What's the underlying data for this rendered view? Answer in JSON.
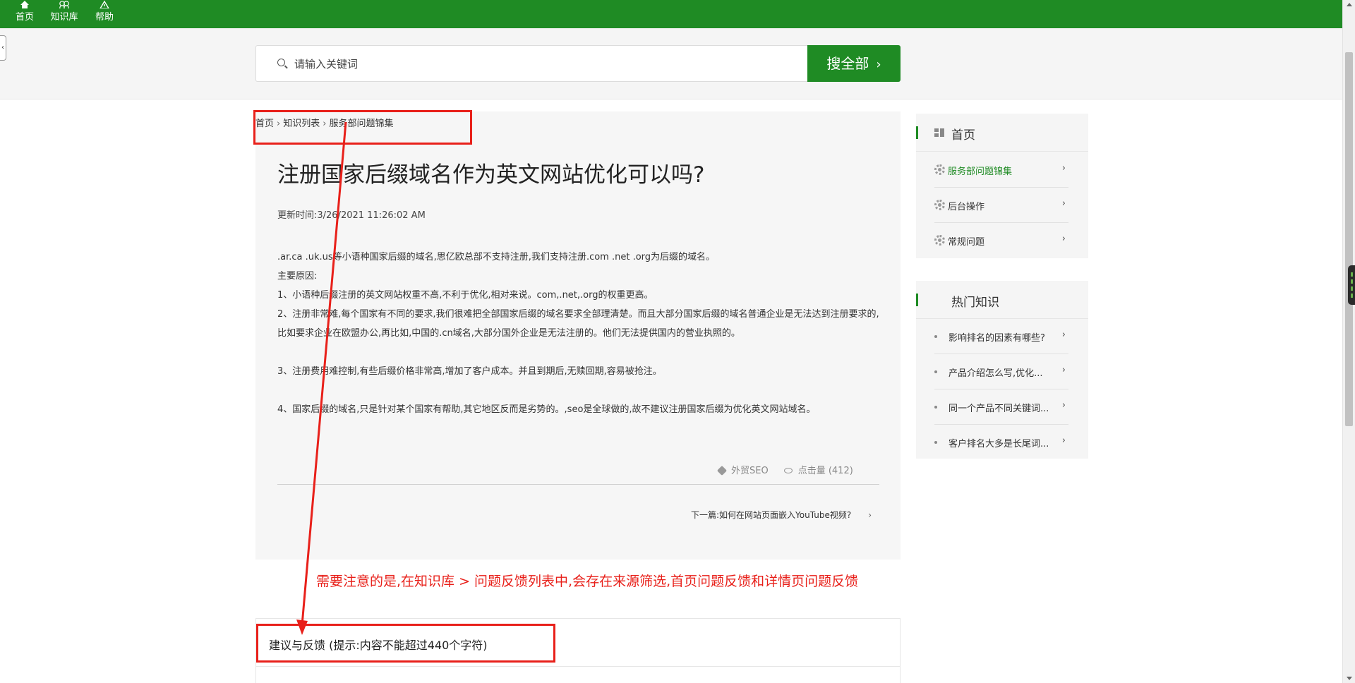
{
  "nav": {
    "items": [
      {
        "label": "首页",
        "icon": "home-icon"
      },
      {
        "label": "知识库",
        "icon": "knowledge-icon"
      },
      {
        "label": "帮助",
        "icon": "help-icon"
      }
    ]
  },
  "search": {
    "placeholder": "请输入关键词",
    "button_label": "搜全部"
  },
  "breadcrumb": {
    "items": [
      "首页",
      "知识列表",
      "服务部问题锦集"
    ]
  },
  "article": {
    "title": "注册国家后缀域名作为英文网站优化可以吗?",
    "updated": "更新时间:3/26/2021 11:26:02 AM",
    "paragraphs": [
      ".ar.ca .uk.us等小语种国家后缀的域名,思亿欧总部不支持注册,我们支持注册.com .net .org为后缀的域名。",
      "主要原因:",
      "1、小语种后缀注册的英文网站权重不高,不利于优化,相对来说。com,.net,.org的权重更高。",
      "2、注册非常难,每个国家有不同的要求,我们很难把全部国家后缀的域名要求全部理清楚。而且大部分国家后缀的域名普通企业是无法达到注册要求的,比如要求企业在欧盟办公,再比如,中国的.cn域名,大部分国外企业是无法注册的。他们无法提供国内的营业执照的。",
      "",
      "3、注册费用难控制,有些后缀价格非常高,增加了客户成本。并且到期后,无赎回期,容易被抢注。",
      "",
      "4、国家后缀的域名,只是针对某个国家有帮助,其它地区反而是劣势的。,seo是全球做的,故不建议注册国家后缀为优化英文网站域名。"
    ],
    "tag": "外贸SEO",
    "views": "点击量 (412)",
    "next_link": "下一篇:如何在网站页面嵌入YouTube视频?"
  },
  "sidebar": {
    "nav_title": "首页",
    "nav_items": [
      {
        "label": "服务部问题锦集",
        "active": true
      },
      {
        "label": "后台操作",
        "active": false
      },
      {
        "label": "常规问题",
        "active": false
      }
    ],
    "hot_title": "热门知识",
    "hot_items": [
      "影响排名的因素有哪些?",
      "产品介绍怎么写,优化...",
      "同一个产品不同关键词...",
      "客户排名大多是长尾词..."
    ]
  },
  "feedback": {
    "title": "建议与反馈 (提示:内容不能超过440个字符)"
  },
  "annotation": {
    "note": "需要注意的是,在知识库 > 问题反馈列表中,会存在来源筛选,首页问题反馈和详情页问题反馈",
    "color": "#e8201a"
  },
  "colors": {
    "brand_green": "#1f8b24"
  }
}
